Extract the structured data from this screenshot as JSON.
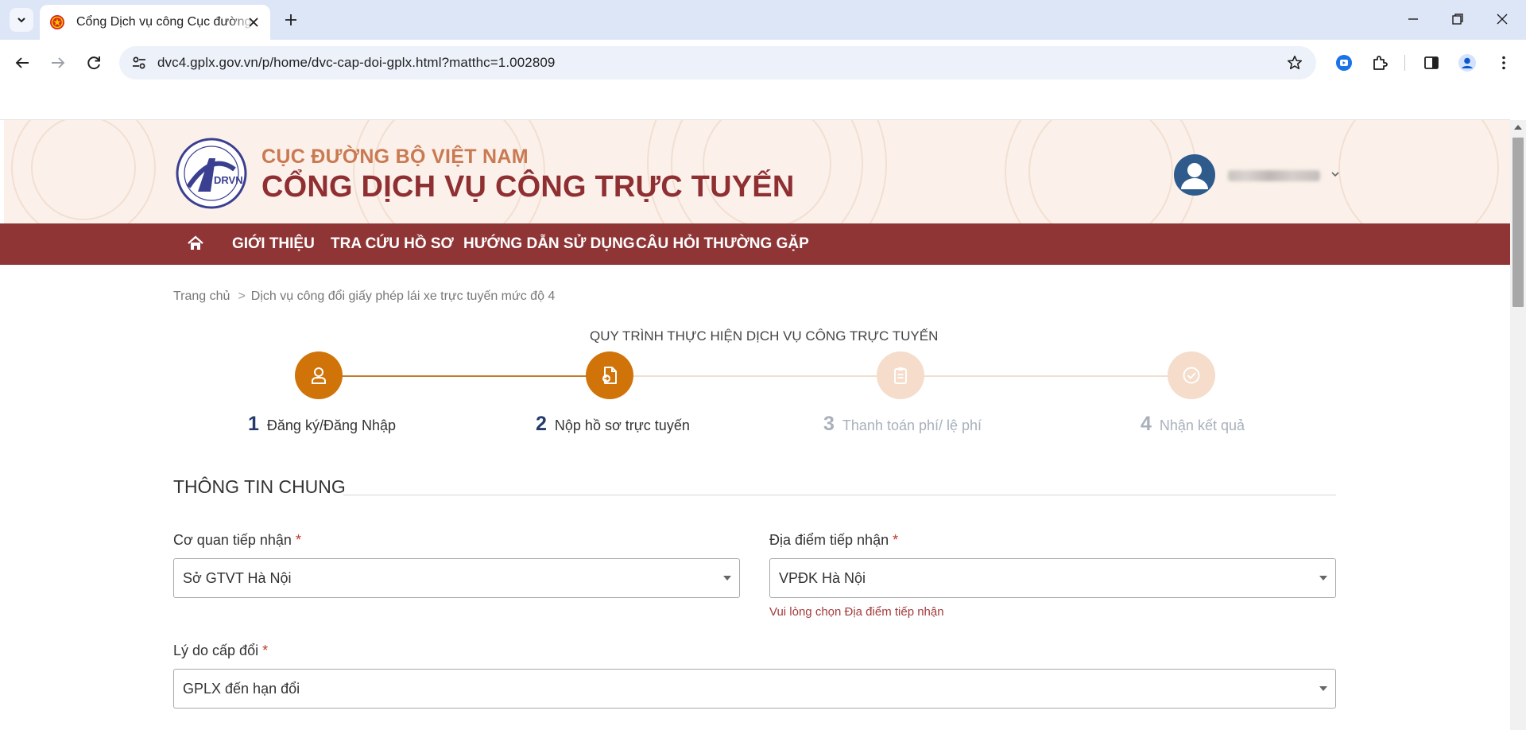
{
  "browser": {
    "tab_title": "Cổng Dịch vụ công Cục đường bộ Việt Nam",
    "url": "dvc4.gplx.gov.vn/p/home/dvc-cap-doi-gplx.html?matthc=1.002809"
  },
  "header": {
    "brand_top": "CỤC ĐƯỜNG BỘ VIỆT NAM",
    "brand_main": "CỔNG DỊCH VỤ CÔNG TRỰC TUYẾN"
  },
  "nav": {
    "items": [
      "GIỚI THIỆU",
      "TRA CỨU HỒ SƠ",
      "HƯỚNG DẪN SỬ DỤNG",
      "CÂU HỎI THƯỜNG GẶP"
    ]
  },
  "breadcrumb": {
    "home": "Trang chủ",
    "separator": ">",
    "current": "Dịch vụ công đổi giấy phép lái xe trực tuyến mức độ 4"
  },
  "process": {
    "title": "QUY TRÌNH THỰC HIỆN DỊCH VỤ CÔNG TRỰC TUYẾN",
    "steps": [
      {
        "num": "1",
        "label": "Đăng ký/Đăng Nhập",
        "state": "done"
      },
      {
        "num": "2",
        "label": "Nộp hồ sơ trực tuyến",
        "state": "active"
      },
      {
        "num": "3",
        "label": "Thanh toán phí/ lệ phí",
        "state": "pending"
      },
      {
        "num": "4",
        "label": "Nhận kết quả",
        "state": "pending"
      }
    ]
  },
  "form": {
    "section_title": "THÔNG TIN CHUNG",
    "required_mark": "*",
    "co_quan": {
      "label": "Cơ quan tiếp nhận",
      "value": "Sở GTVT Hà Nội"
    },
    "dia_diem": {
      "label": "Địa điểm tiếp nhận",
      "value": "VPĐK Hà Nội",
      "error": "Vui lòng chọn Địa điểm tiếp nhận"
    },
    "ly_do": {
      "label": "Lý do cấp đổi",
      "value": "GPLX đến hạn đổi"
    }
  },
  "colors": {
    "brand_red": "#8f3536",
    "step_active": "#d0740a",
    "step_pending": "#f5dccb",
    "header_bg": "#fbf1ea"
  }
}
